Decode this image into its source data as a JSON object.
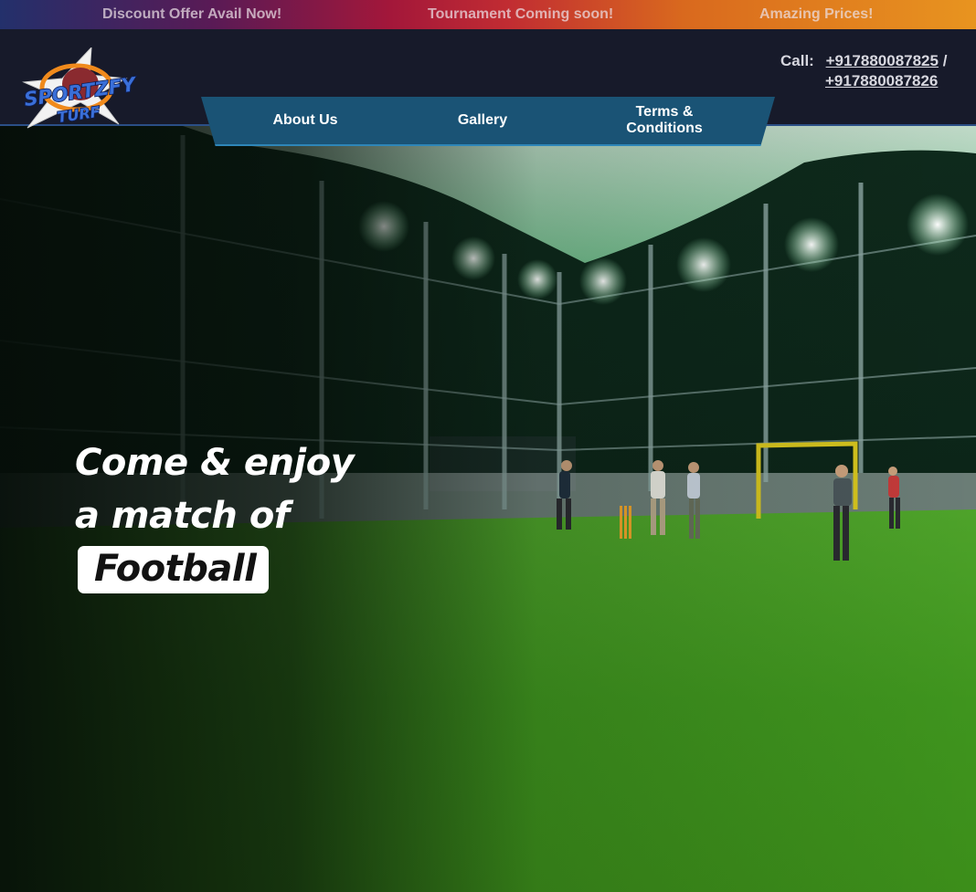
{
  "ticker": {
    "items": [
      "Discount Offer Avail Now!",
      "Tournament Coming soon!",
      "Amazing Prices!"
    ]
  },
  "brand": {
    "logo_line1": "SPORTZFY",
    "logo_line2": "TURF"
  },
  "nav": {
    "items": [
      {
        "label": "About Us"
      },
      {
        "label": "Gallery"
      },
      {
        "label": "Terms & Conditions"
      }
    ]
  },
  "contact": {
    "label": "Call:",
    "phone1": "+917880087825",
    "separator": "/",
    "phone2": "+917880087826"
  },
  "hero": {
    "line1": "Come & enjoy",
    "line2": "a match of",
    "sport": "Football"
  },
  "colors": {
    "header_bg": "#171a2a",
    "nav_bg": "#1a5375",
    "turf_green": "#3f9a1e",
    "ticker_start": "#23306b",
    "ticker_end": "#e8941f"
  }
}
